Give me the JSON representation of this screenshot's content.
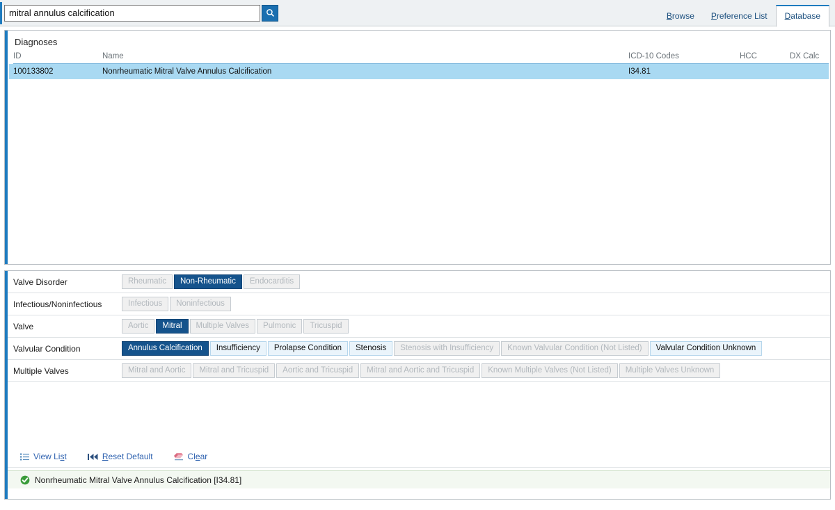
{
  "search": {
    "value": "mitral annulus calcification",
    "placeholder": "",
    "button_icon": "search-icon"
  },
  "tabs": [
    {
      "label": "Browse",
      "accel": "B",
      "active": false
    },
    {
      "label": "Preference List",
      "accel": "P",
      "active": false
    },
    {
      "label": "Database",
      "accel": "D",
      "active": true
    }
  ],
  "results": {
    "title": "Diagnoses",
    "columns": [
      "ID",
      "Name",
      "ICD-10 Codes",
      "HCC",
      "DX Calc"
    ],
    "rows": [
      {
        "id": "100133802",
        "name": "Nonrheumatic Mitral Valve Annulus Calcification",
        "icd10": "I34.81",
        "hcc": "",
        "dx_calc": "",
        "selected": true
      }
    ]
  },
  "criteria": [
    {
      "label": "Valve Disorder",
      "options": [
        {
          "text": "Rheumatic",
          "state": "disabled"
        },
        {
          "text": "Non-Rheumatic",
          "state": "selected"
        },
        {
          "text": "Endocarditis",
          "state": "disabled"
        }
      ]
    },
    {
      "label": "Infectious/Noninfectious",
      "options": [
        {
          "text": "Infectious",
          "state": "disabled"
        },
        {
          "text": "Noninfectious",
          "state": "disabled"
        }
      ]
    },
    {
      "label": "Valve",
      "options": [
        {
          "text": "Aortic",
          "state": "disabled"
        },
        {
          "text": "Mitral",
          "state": "selected"
        },
        {
          "text": "Multiple Valves",
          "state": "disabled"
        },
        {
          "text": "Pulmonic",
          "state": "disabled"
        },
        {
          "text": "Tricuspid",
          "state": "disabled"
        }
      ]
    },
    {
      "label": "Valvular Condition",
      "options": [
        {
          "text": "Annulus Calcification",
          "state": "selected"
        },
        {
          "text": "Insufficiency",
          "state": "enabled"
        },
        {
          "text": "Prolapse Condition",
          "state": "enabled"
        },
        {
          "text": "Stenosis",
          "state": "enabled"
        },
        {
          "text": "Stenosis with Insufficiency",
          "state": "disabled"
        },
        {
          "text": "Known Valvular Condition (Not Listed)",
          "state": "disabled"
        },
        {
          "text": "Valvular Condition Unknown",
          "state": "enabled"
        }
      ]
    },
    {
      "label": "Multiple Valves",
      "options": [
        {
          "text": "Mitral and Aortic",
          "state": "disabled"
        },
        {
          "text": "Mitral and Tricuspid",
          "state": "disabled"
        },
        {
          "text": "Aortic and Tricuspid",
          "state": "disabled"
        },
        {
          "text": "Mitral and Aortic and Tricuspid",
          "state": "disabled"
        },
        {
          "text": "Known Multiple Valves (Not Listed)",
          "state": "disabled"
        },
        {
          "text": "Multiple Valves Unknown",
          "state": "disabled"
        }
      ]
    }
  ],
  "actions": [
    {
      "label": "View List",
      "accel": "s",
      "icon": "list-icon"
    },
    {
      "label": "Reset Default",
      "accel": "R",
      "icon": "rewind-icon"
    },
    {
      "label": "Clear",
      "accel": "e",
      "icon": "eraser-icon"
    }
  ],
  "status": {
    "icon": "check-circle-icon",
    "text": "Nonrheumatic Mitral Valve Annulus Calcification [I34.81]"
  },
  "colors": {
    "accent_blue": "#1e7bbf",
    "selected_pill": "#15538c",
    "enabled_pill": "#eaf4fb",
    "row_selected": "#a9d9f2",
    "status_green": "#3a9c3a",
    "link_blue": "#2b5fae"
  }
}
